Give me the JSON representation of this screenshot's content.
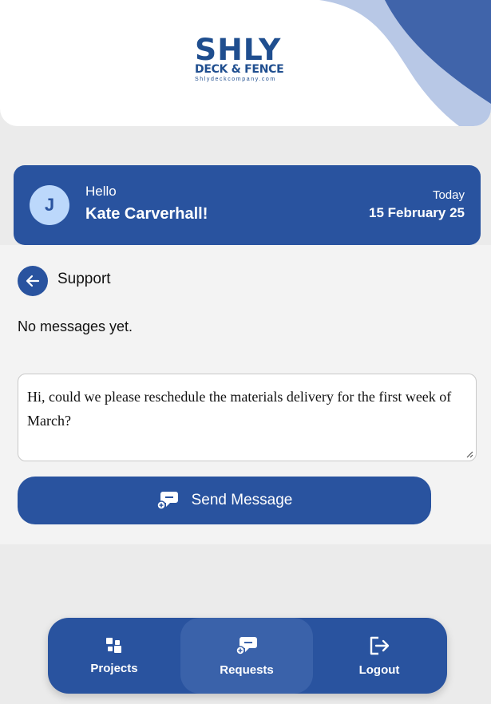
{
  "brand": {
    "name": "SHLY",
    "tagline": "DECK & FENCE",
    "url": "Shlydeckcompany.com",
    "accent_color": "#29539f"
  },
  "greeting": {
    "avatar_initial": "J",
    "hello": "Hello",
    "user_name": "Kate Carverhall!",
    "today_label": "Today",
    "date": "15 February 25"
  },
  "support": {
    "back_icon": "arrow-left-icon",
    "title": "Support",
    "empty_text": "No messages yet.",
    "message_value": "Hi, could we please reschedule the materials delivery for the first week of March?",
    "send_label": "Send Message",
    "send_icon": "chat-add-icon"
  },
  "nav": {
    "items": [
      {
        "label": "Projects",
        "icon": "grid-icon",
        "active": false
      },
      {
        "label": "Requests",
        "icon": "chat-add-icon",
        "active": true
      },
      {
        "label": "Logout",
        "icon": "logout-icon",
        "active": false
      }
    ]
  }
}
